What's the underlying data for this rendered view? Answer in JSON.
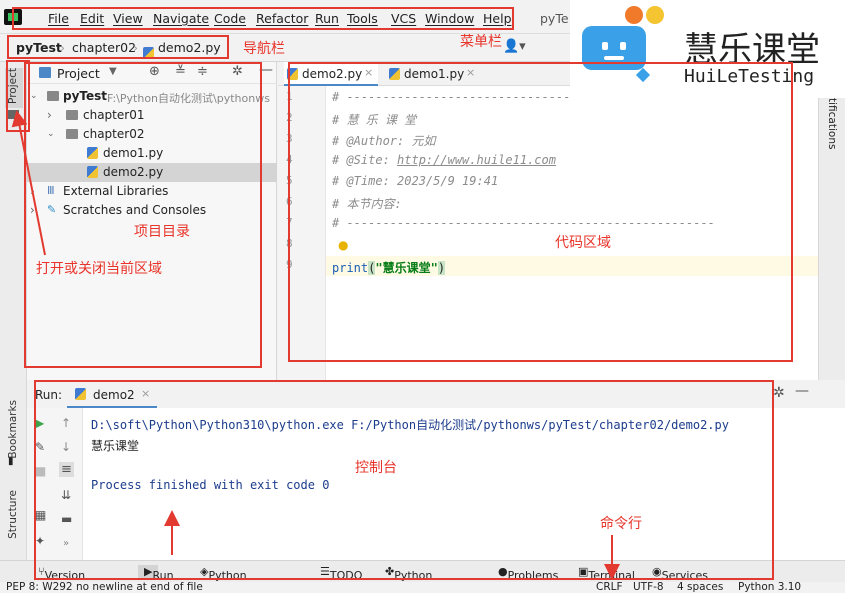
{
  "menu": {
    "items": [
      "File",
      "Edit",
      "View",
      "Navigate",
      "Code",
      "Refactor",
      "Run",
      "Tools",
      "VCS",
      "Window",
      "Help"
    ],
    "title_fragment": "pyTe"
  },
  "navbar": {
    "crumbs": [
      "pyTest",
      "chapter02",
      "demo2.py"
    ]
  },
  "left_strip": {
    "project_label": "Project",
    "bookmarks_label": "Bookmarks",
    "structure_label": "Structure"
  },
  "project": {
    "header": "Project",
    "tree": [
      {
        "label": "pyTest",
        "path": "F:\\Python自动化测试\\pythonws"
      },
      {
        "label": "chapter01"
      },
      {
        "label": "chapter02"
      },
      {
        "label": "demo1.py"
      },
      {
        "label": "demo2.py"
      },
      {
        "label": "External Libraries"
      },
      {
        "label": "Scratches and Consoles"
      }
    ]
  },
  "editor": {
    "tabs": [
      "demo2.py",
      "demo1.py"
    ],
    "line_numbers": [
      "1",
      "2",
      "3",
      "4",
      "5",
      "6",
      "7",
      "8",
      "9"
    ],
    "code": [
      "# ---------------------------------------------------",
      "# 慧 乐 课 堂",
      "# @Author: 元如",
      "# @Site: ",
      "# @Time: 2023/5/9 19:41",
      "# 本节内容:",
      "# ---------------------------------------------------",
      ""
    ],
    "site_url": "http://www.huile11.com",
    "print_kw": "print",
    "print_open": "(",
    "print_arg": "\"慧乐课堂\"",
    "print_close": ")",
    "right_strip_label": "tifications"
  },
  "run": {
    "label": "Run:",
    "tab": "demo2",
    "command": "D:\\soft\\Python\\Python310\\python.exe F:/Python自动化测试/pythonws/pyTest/chapter02/demo2.py",
    "output": "慧乐课堂",
    "finished": "Process finished with exit code 0"
  },
  "toolwindows": [
    "Version Control",
    "Run",
    "Python Packages",
    "TODO",
    "Python Console",
    "Problems",
    "Terminal",
    "Services"
  ],
  "status": {
    "message": "PEP 8: W292 no newline at end of file",
    "line_sep": "CRLF",
    "encoding": "UTF-8",
    "indent": "4 spaces",
    "interpreter": "Python 3.10"
  },
  "annotations": {
    "menu": "菜单栏",
    "nav": "导航栏",
    "project": "项目目录",
    "toggle": "打开或关闭当前区域",
    "code": "代码区域",
    "console": "控制台",
    "terminal": "命令行"
  },
  "brand": {
    "cn": "慧乐课堂",
    "en": "HuiLeTesting",
    "colors": [
      "#f07a2a",
      "#f5c431",
      "#3aa0e8"
    ]
  }
}
